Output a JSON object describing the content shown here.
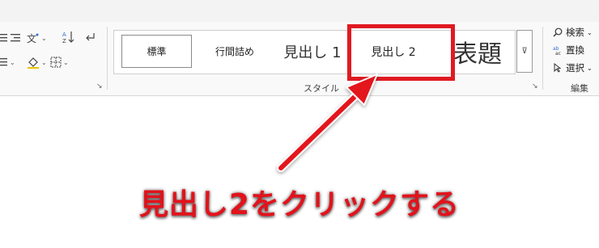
{
  "ribbon": {
    "paragraph_group": {
      "launcher": "↘"
    },
    "styles_group": {
      "label": "スタイル",
      "launcher": "↘",
      "items": [
        {
          "label": "標準"
        },
        {
          "label": "行間詰め"
        },
        {
          "label": "見出し 1"
        },
        {
          "label": "見出し 2"
        },
        {
          "label": "表題"
        }
      ],
      "scroll_glyph": "⊽"
    },
    "editing_group": {
      "label": "編集",
      "items": [
        {
          "label": "検索",
          "icon": "search-icon",
          "dropdown": true
        },
        {
          "label": "置換",
          "icon": "replace-icon",
          "dropdown": false
        },
        {
          "label": "選択",
          "icon": "select-icon",
          "dropdown": true
        }
      ]
    }
  },
  "annotation": {
    "callout": "見出し2をクリックする",
    "highlight_color": "#e01a22",
    "arrow_color": "#e3121b"
  }
}
